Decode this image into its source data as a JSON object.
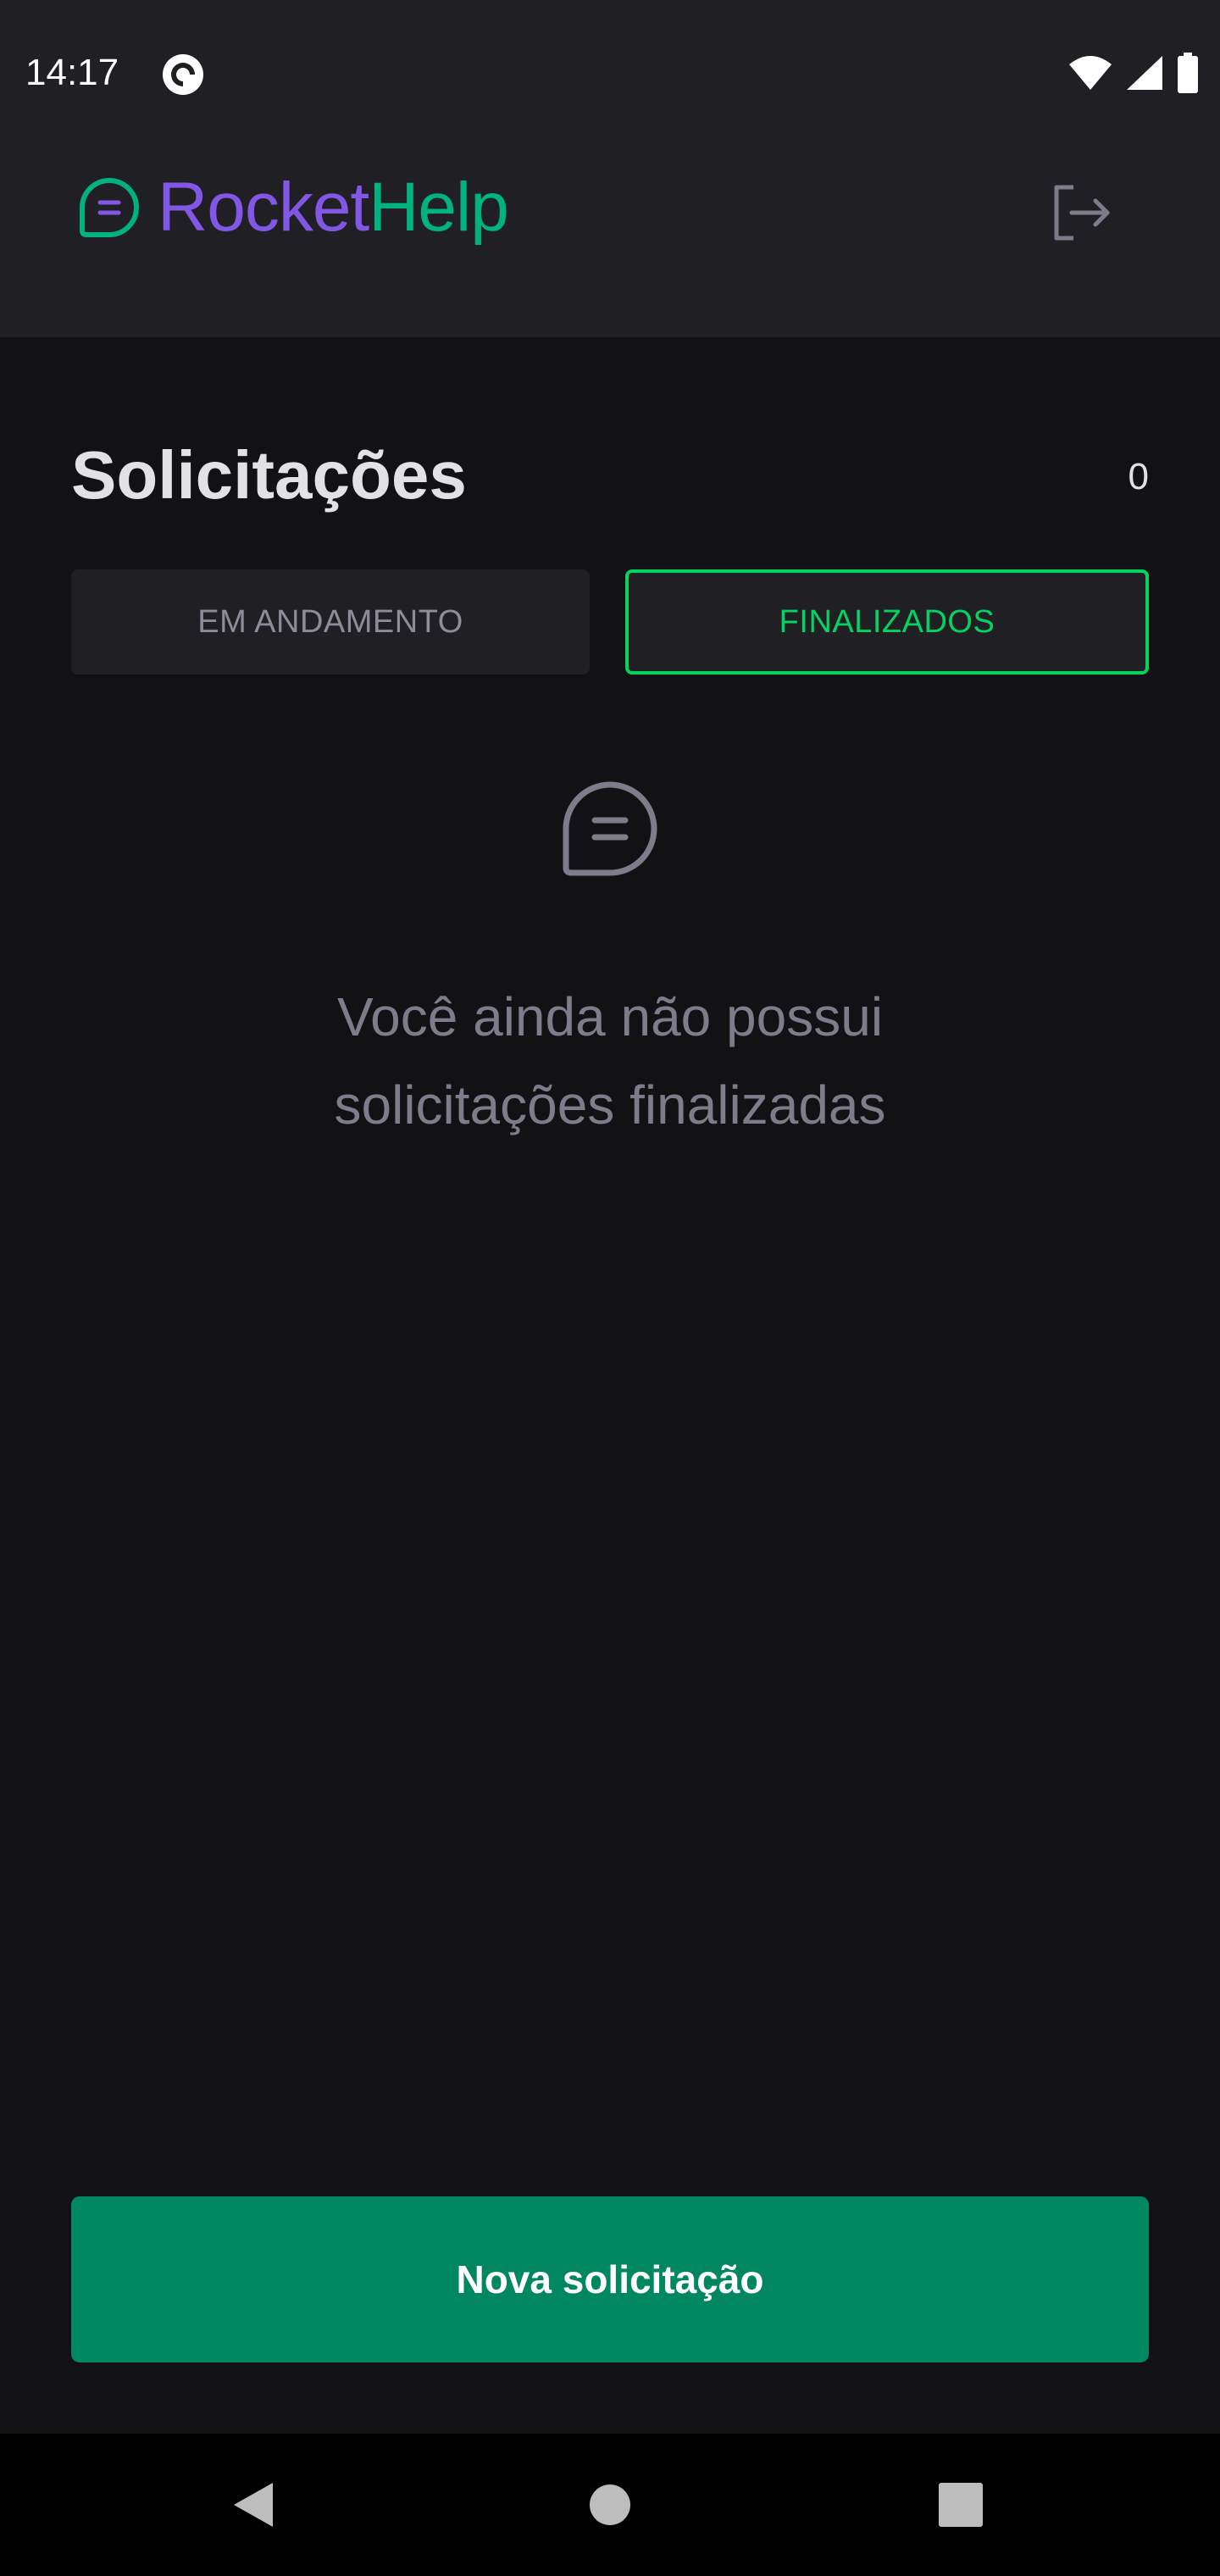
{
  "status_bar": {
    "time": "14:17",
    "app_icon": "pocket-casts-icon",
    "icons": [
      "wifi-icon",
      "cellular-signal-icon",
      "battery-icon"
    ]
  },
  "header": {
    "brand_part1": "Rocket",
    "brand_part2": "Help",
    "brand_icon": "chat-bubble-icon",
    "logout_icon": "sign-out-icon"
  },
  "main": {
    "title": "Solicitações",
    "count": "0",
    "filters": [
      {
        "label": "EM ANDAMENTO",
        "selected": false
      },
      {
        "label": "FINALIZADOS",
        "selected": true
      }
    ],
    "empty_state": {
      "icon": "chat-bubble-icon",
      "line1": "Você ainda não possui",
      "line2": "solicitações finalizadas"
    },
    "primary_button": "Nova solicitação"
  },
  "navigation_bar": {
    "buttons": [
      "back-icon",
      "home-icon",
      "recents-icon"
    ]
  },
  "colors": {
    "background": "#121214",
    "surface": "#202024",
    "brand_purple": "#8257e5",
    "brand_green": "#00b37e",
    "selected_filter": "#04d361",
    "primary_button": "#00875f",
    "muted_text": "#7c7c8a"
  }
}
